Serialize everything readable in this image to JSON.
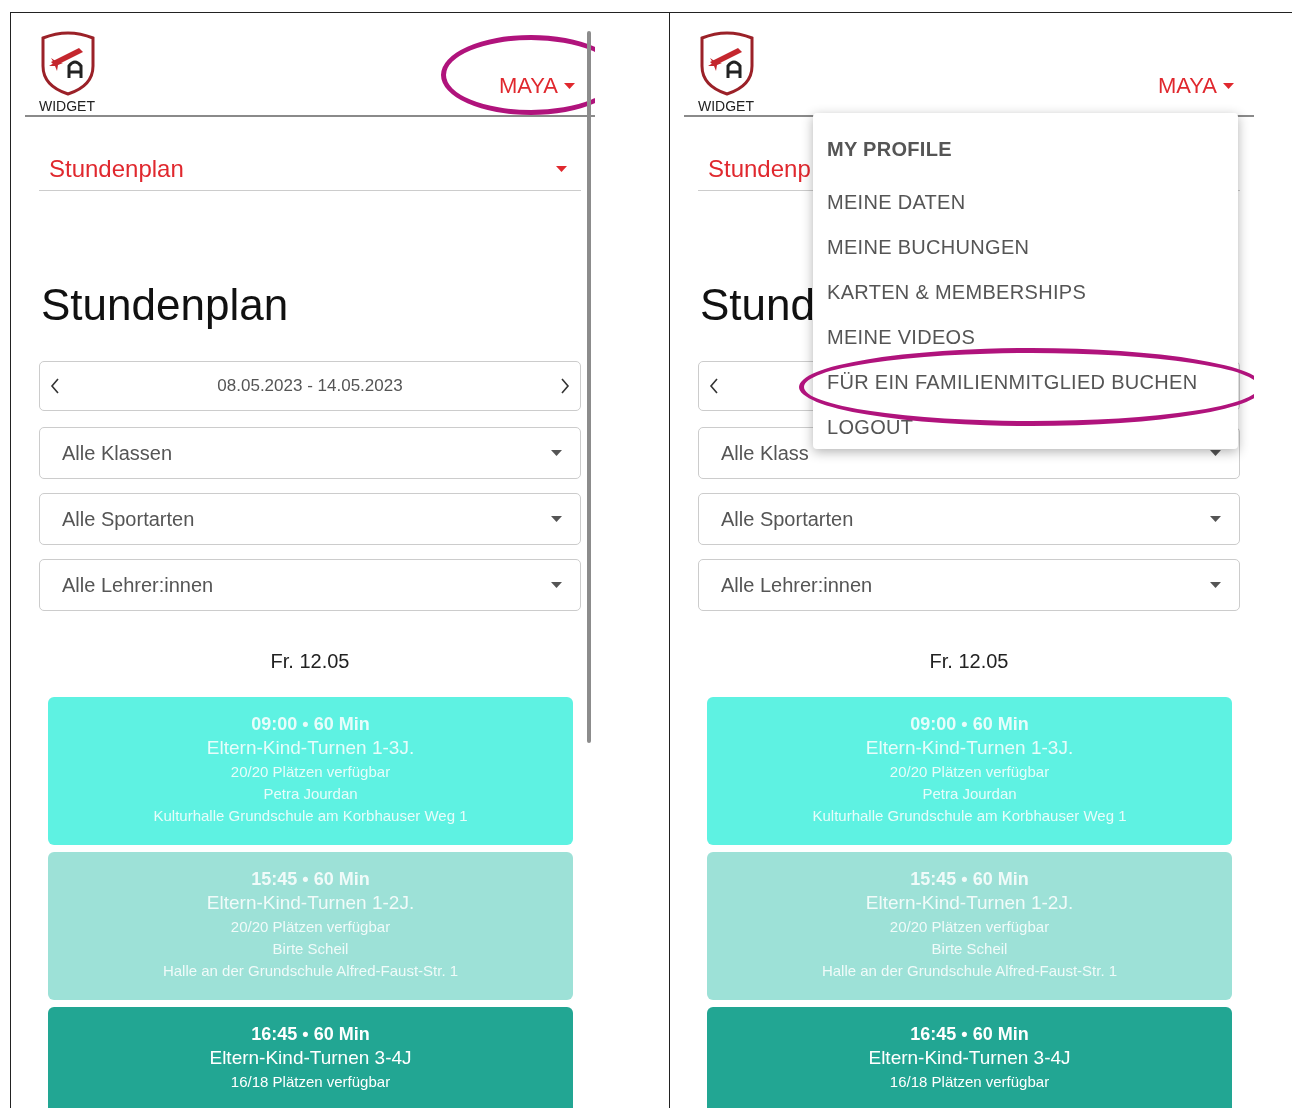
{
  "panels": [
    {
      "header": {
        "widget_label": "WIDGET",
        "user_menu": {
          "label": "MAYA",
          "circled": true
        }
      },
      "section_select": "Stundenplan",
      "title": "Stundenplan",
      "week_range": "08.05.2023 - 14.05.2023",
      "week_next": true,
      "scrollbar": true,
      "filters": [
        "Alle Klassen",
        "Alle Sportarten",
        "Alle Lehrer:innen"
      ],
      "day": "Fr. 12.05",
      "classes": [
        {
          "time": "09:00 • 60 Min",
          "name": "Eltern-Kind-Turnen 1-3J.",
          "spots": "20/20 Plätzen verfügbar",
          "teacher": "Petra Jourdan",
          "location": "Kulturhalle Grundschule am Korbhauser Weg 1",
          "color": "#5ef2e2"
        },
        {
          "time": "15:45 • 60 Min",
          "name": "Eltern-Kind-Turnen 1-2J.",
          "spots": "20/20 Plätzen verfügbar",
          "teacher": "Birte Scheil",
          "location": "Halle an der Grundschule Alfred-Faust-Str. 1",
          "color": "#9de1d7"
        },
        {
          "time": "16:45 • 60 Min",
          "name": "Eltern-Kind-Turnen 3-4J",
          "spots": "16/18 Plätzen verfügbar",
          "color": "#22a693"
        }
      ]
    },
    {
      "header": {
        "widget_label": "WIDGET",
        "user_menu": {
          "label": "MAYA",
          "circled": false
        }
      },
      "section_select": "Stundenp",
      "title": "Stund",
      "week_next": false,
      "scrollbar": false,
      "filters": [
        "Alle Klass",
        "Alle Sportarten",
        "Alle Lehrer:innen"
      ],
      "day": "Fr. 12.05",
      "classes": [
        {
          "time": "09:00 • 60 Min",
          "name": "Eltern-Kind-Turnen 1-3J.",
          "spots": "20/20 Plätzen verfügbar",
          "teacher": "Petra Jourdan",
          "location": "Kulturhalle Grundschule am Korbhauser Weg 1",
          "color": "#5ef2e2"
        },
        {
          "time": "15:45 • 60 Min",
          "name": "Eltern-Kind-Turnen 1-2J.",
          "spots": "20/20 Plätzen verfügbar",
          "teacher": "Birte Scheil",
          "location": "Halle an der Grundschule Alfred-Faust-Str. 1",
          "color": "#9de1d7"
        },
        {
          "time": "16:45 • 60 Min",
          "name": "Eltern-Kind-Turnen 3-4J",
          "spots": "16/18 Plätzen verfügbar",
          "color": "#22a693"
        }
      ],
      "menu": {
        "items": [
          {
            "kind": "heading",
            "label": "MY PROFILE",
            "circled": false
          },
          {
            "kind": "item",
            "label": "MEINE DATEN",
            "circled": false
          },
          {
            "kind": "item",
            "label": "MEINE BUCHUNGEN",
            "circled": false
          },
          {
            "kind": "item",
            "label": "KARTEN & MEMBERSHIPS",
            "circled": false
          },
          {
            "kind": "item",
            "label": "MEINE VIDEOS",
            "circled": false
          },
          {
            "kind": "item",
            "label": "FÜR EIN FAMILIENMITGLIED BUCHEN",
            "circled": true
          },
          {
            "kind": "item",
            "label": "LOGOUT",
            "circled": false
          }
        ]
      }
    }
  ]
}
